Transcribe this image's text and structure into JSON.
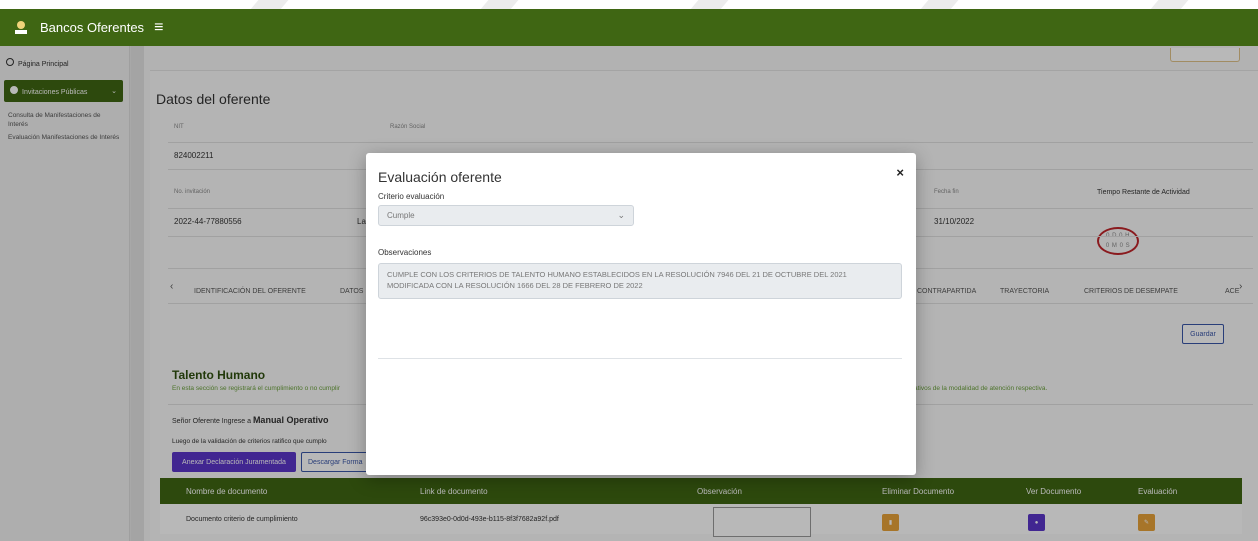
{
  "header": {
    "title": "Bancos Oferentes",
    "menu_icon": "hamburger-icon"
  },
  "sidebar": {
    "home": "Página Principal",
    "invitations": "Invitaciones Públicas",
    "sub1": "Consulta de Manifestaciones de Interés",
    "sub2": "Evaluación Manifestaciones de Interés"
  },
  "datos": {
    "title": "Datos del oferente",
    "nit_label": "NIT",
    "nit_value": "824002211",
    "razon_label": "Razón Social",
    "invitacion_label": "No. invitación",
    "invitacion_value": "2022-44-77880556",
    "invitacion_extra": "La",
    "fecha_fin_label": "Fecha fin",
    "fecha_fin_value": "31/10/2022",
    "tiempo_label": "Tiempo Restante de Actividad",
    "tiempo_line1": "0 D 0 H",
    "tiempo_line2": "0 M 0 S"
  },
  "tabs": {
    "prev": "‹",
    "t1": "IDENTIFICACIÓN DEL OFERENTE",
    "t2": "DATOS",
    "t3": "CONTRAPARTIDA",
    "t4": "TRAYECTORIA",
    "t5": "CRITERIOS DE DESEMPATE",
    "t6": "ACE",
    "next": "›"
  },
  "guardar": "Guardar",
  "talento": {
    "title": "Talento Humano",
    "desc_left": "En esta sección se registrará el cumplimiento o no cumplir",
    "desc_right": "ativos de la modalidad de atención respectiva.",
    "senor": "Señor Oferente Ingrese a ",
    "manual": "Manual Operativo",
    "luego": "Luego de la validación de criterios ratifico que cumplo",
    "btn_anexar": "Anexar Declaración Juramentada",
    "btn_descargar": "Descargar Forma"
  },
  "table": {
    "headers": [
      "Nombre de documento",
      "Link de documento",
      "Observación",
      "Eliminar Documento",
      "Ver Documento",
      "Evaluación"
    ],
    "row": {
      "nombre": "Documento criterio de cumplimiento",
      "link": "96c393e0-0d0d-493e-b115-8f3f7682a92f.pdf"
    }
  },
  "modal": {
    "title": "Evaluación oferente",
    "close": "×",
    "criterio_label": "Criterio evaluación",
    "criterio_value": "Cumple",
    "obs_label": "Observaciones",
    "obs_value": "CUMPLE CON LOS CRITERIOS DE TALENTO HUMANO ESTABLECIDOS EN LA RESOLUCIÓN 7946 DEL 21 DE OCTUBRE DEL 2021 MODIFICADA CON LA RESOLUCIÓN 1666 DEL 28 DE FEBRERO DE 2022"
  },
  "colors": {
    "brand_green": "#3f6613",
    "purple": "#5b35c9",
    "orange": "#e8a23a",
    "timer_red": "#c0242a"
  }
}
